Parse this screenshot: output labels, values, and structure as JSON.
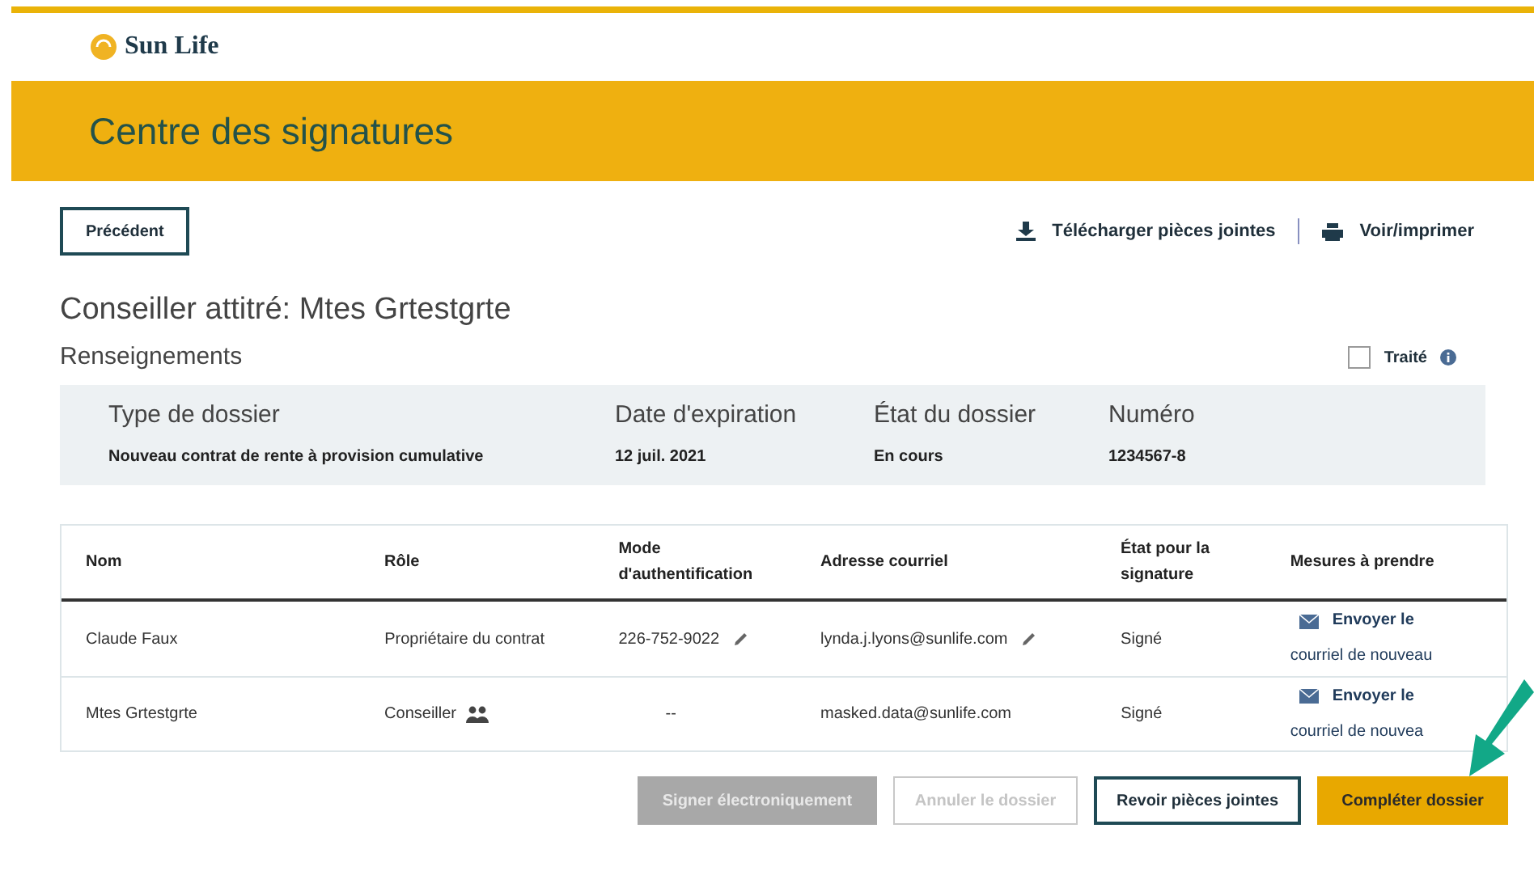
{
  "logo": {
    "text": "Sun Life"
  },
  "banner": {
    "title": "Centre des signatures"
  },
  "back_button": "Précédent",
  "actions": [
    {
      "kind": "download",
      "label": "Télécharger pièces jointes"
    },
    {
      "kind": "print",
      "label": "Voir/imprimer"
    }
  ],
  "advisor": "Conseiller attitré: Mtes Grtestgrte",
  "section": "Renseignements",
  "treated": {
    "label": "Traité",
    "checked": false
  },
  "summary": [
    {
      "label": "Type de dossier",
      "value": "Nouveau contrat de rente à provision cumulative"
    },
    {
      "label": "Date d'expiration",
      "value": "12 juil. 2021"
    },
    {
      "label": "État du dossier",
      "value": "En cours"
    },
    {
      "label": "Numéro",
      "value": "1234567-8"
    }
  ],
  "table": {
    "columns": [
      "Nom",
      "Rôle",
      "Mode d'authentification",
      "Adresse courriel",
      "État pour la signature",
      "Mesures à prendre"
    ],
    "rows": [
      {
        "name": "Claude Faux",
        "role": "Propriétaire du contrat",
        "role_icon": false,
        "auth": "226-752-9022",
        "auth_editable": true,
        "email": "lynda.j.lyons@sunlife.com",
        "email_editable": true,
        "status": "Signé",
        "action_line1": "Envoyer le",
        "action_line2": "courriel de nouveau"
      },
      {
        "name": "Mtes Grtestgrte",
        "role": "Conseiller",
        "role_icon": true,
        "auth": "--",
        "auth_editable": false,
        "email": "masked.data@sunlife.com",
        "email_editable": false,
        "status": "Signé",
        "action_line1": "Envoyer le",
        "action_line2": "courriel de nouvea"
      }
    ]
  },
  "buttons": [
    {
      "label": "Signer électroniquement",
      "kind": "disabled-filled"
    },
    {
      "label": "Annuler le dossier",
      "kind": "disabled-outline"
    },
    {
      "label": "Revoir pièces jointes",
      "kind": "outline"
    },
    {
      "label": "Compléter dossier",
      "kind": "primary"
    }
  ]
}
